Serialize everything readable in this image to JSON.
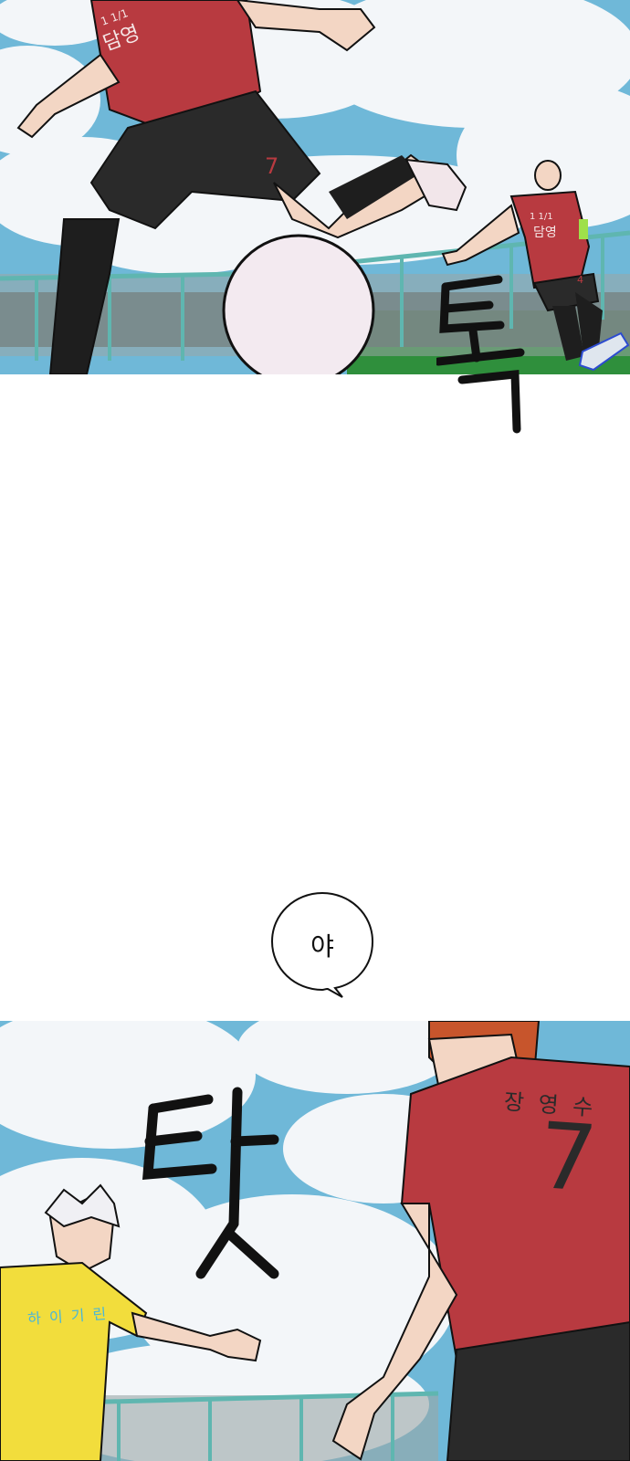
{
  "panels": [
    {
      "id": "panel-1",
      "jersey_texts": [
        "1 1/1",
        "담영",
        "1 1/1",
        "담영",
        "7",
        "4"
      ],
      "sfx": "툭"
    },
    {
      "id": "panel-2",
      "speech": "야"
    },
    {
      "id": "panel-3",
      "sfx": "탓",
      "jersey_texts": [
        "장 영 수",
        "7",
        "하 이 기 린"
      ]
    }
  ],
  "colors": {
    "sky": "#6fb8d8",
    "cloud": "#f4f7fa",
    "red_jersey": "#b83a40",
    "black_shorts": "#2a2a2a",
    "yellow_jersey": "#f2dd3c",
    "grass": "#2f8f3c",
    "fence": "#5fb6b0",
    "ink": "#111111"
  }
}
